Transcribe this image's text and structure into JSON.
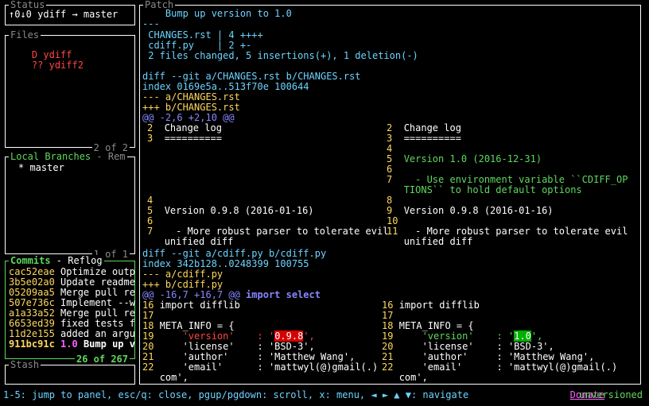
{
  "status": {
    "title": "Status",
    "text": "↑0↓0 ydiff → master"
  },
  "files": {
    "title": "Files",
    "items": [
      {
        "flag": "D",
        "name": "ydiff"
      },
      {
        "flag": "??",
        "name": "ydiff2"
      }
    ],
    "footer": "2 of 2"
  },
  "branches": {
    "title_active": "Local Branches",
    "title_sep": " - ",
    "title_other": "Rem",
    "items": [
      "* master"
    ],
    "footer": "1 of 1"
  },
  "commits": {
    "title_active": "Commits",
    "title_sep": " - ",
    "title_other": "Reflog",
    "items": [
      {
        "sha": "cac52eae",
        "msg": "Optimize outp"
      },
      {
        "sha": "3b5e02a0",
        "msg": "Update readme"
      },
      {
        "sha": "05209aa5",
        "msg": "Merge pull re"
      },
      {
        "sha": "507e736c",
        "msg": "Implement --w"
      },
      {
        "sha": "a1a33a52",
        "msg": "Merge pull re"
      },
      {
        "sha": "6653ed39",
        "msg": "fixed tests f"
      },
      {
        "sha": "11d2e155",
        "msg": "added an argu"
      },
      {
        "sha": "911bc91c",
        "tag": "1.0",
        "msg": "Bump up v"
      }
    ],
    "footer": "26 of 267"
  },
  "stash": {
    "title": "Stash"
  },
  "patch": {
    "title": "Patch",
    "header": [
      "    Bump up version to 1.0",
      "---",
      " CHANGES.rst | 4 ++++",
      " cdiff.py    | 2 +-",
      " 2 files changed, 5 insertions(+), 1 deletion(-)"
    ],
    "file1_diff": "diff --git a/CHANGES.rst b/CHANGES.rst",
    "file1_index": "index 0169e5a..513f70e 100644",
    "file1_old": "--- a/CHANGES.rst",
    "file1_new": "+++ b/CHANGES.rst",
    "file1_hunk": "@@ -2,6 +2,10 @@",
    "file1_left": [
      {
        "n": "2",
        "t": "Change log"
      },
      {
        "n": "3",
        "t": "=========="
      },
      {
        "n": "",
        "t": ""
      },
      {
        "n": "",
        "t": ""
      },
      {
        "n": "",
        "t": ""
      },
      {
        "n": "",
        "t": ""
      },
      {
        "n": "",
        "t": ""
      },
      {
        "n": "4",
        "t": ""
      },
      {
        "n": "5",
        "t": "Version 0.9.8 (2016-01-16)"
      },
      {
        "n": "6",
        "t": ""
      },
      {
        "n": "7",
        "t": "  - More robust parser to tolerate evil"
      },
      {
        "n": "",
        "t": "unified diff"
      }
    ],
    "file1_right": [
      {
        "n": "2",
        "t": "Change log"
      },
      {
        "n": "3",
        "t": "=========="
      },
      {
        "n": "4",
        "t": ""
      },
      {
        "n": "5",
        "t": "Version 1.0 (2016-12-31)"
      },
      {
        "n": "6",
        "t": ""
      },
      {
        "n": "7",
        "t": "  - Use environment variable ``CDIFF_OP"
      },
      {
        "n": "",
        "t": "TIONS`` to hold default options"
      },
      {
        "n": "8",
        "t": ""
      },
      {
        "n": "9",
        "t": "Version 0.9.8 (2016-01-16)"
      },
      {
        "n": "10",
        "t": ""
      },
      {
        "n": "11",
        "t": "  - More robust parser to tolerate evil"
      },
      {
        "n": "",
        "t": "unified diff"
      }
    ],
    "file2_diff": "diff --git a/cdiff.py b/cdiff.py",
    "file2_index": "index 342b128..0248399 100755",
    "file2_old": "--- a/cdiff.py",
    "file2_new": "+++ b/cdiff.py",
    "file2_hunk": "@@ -16,7 +16,7 @@",
    "file2_hunk_ctx": " import select",
    "file2_left": [
      {
        "n": "16",
        "t": "import difflib"
      },
      {
        "n": "17",
        "t": ""
      },
      {
        "n": "18",
        "t": "META_INFO = {"
      },
      {
        "n": "19",
        "t": ""
      },
      {
        "n": "20",
        "t": "    'license'    : 'BSD-3',"
      },
      {
        "n": "21",
        "t": "    'author'     : 'Matthew Wang',"
      },
      {
        "n": "22",
        "t": "    'email'      : 'mattwyl(@)gmail(.)"
      },
      {
        "n": "",
        "t": "com',"
      }
    ],
    "file2_right": [
      {
        "n": "16",
        "t": "import difflib"
      },
      {
        "n": "17",
        "t": ""
      },
      {
        "n": "18",
        "t": "META_INFO = {"
      },
      {
        "n": "19",
        "t": ""
      },
      {
        "n": "20",
        "t": "    'license'    : 'BSD-3',"
      },
      {
        "n": "21",
        "t": "    'author'     : 'Matthew Wang',"
      },
      {
        "n": "22",
        "t": "    'email'      : 'mattwyl(@)gmail(.)"
      },
      {
        "n": "",
        "t": "com',"
      }
    ],
    "ver_key": "    'version'",
    "ver_colon": "    : '",
    "ver_old_hl": "0.9.8",
    "ver_new_hl": "1.0",
    "ver_end": "',"
  },
  "footer": {
    "help": "1-5: jump to panel, esc/q: close, pgup/pgdown: scroll, x: menu, ◄ ► ▲ ▼: navigate",
    "donate": "Donate",
    "version": "unversioned"
  }
}
